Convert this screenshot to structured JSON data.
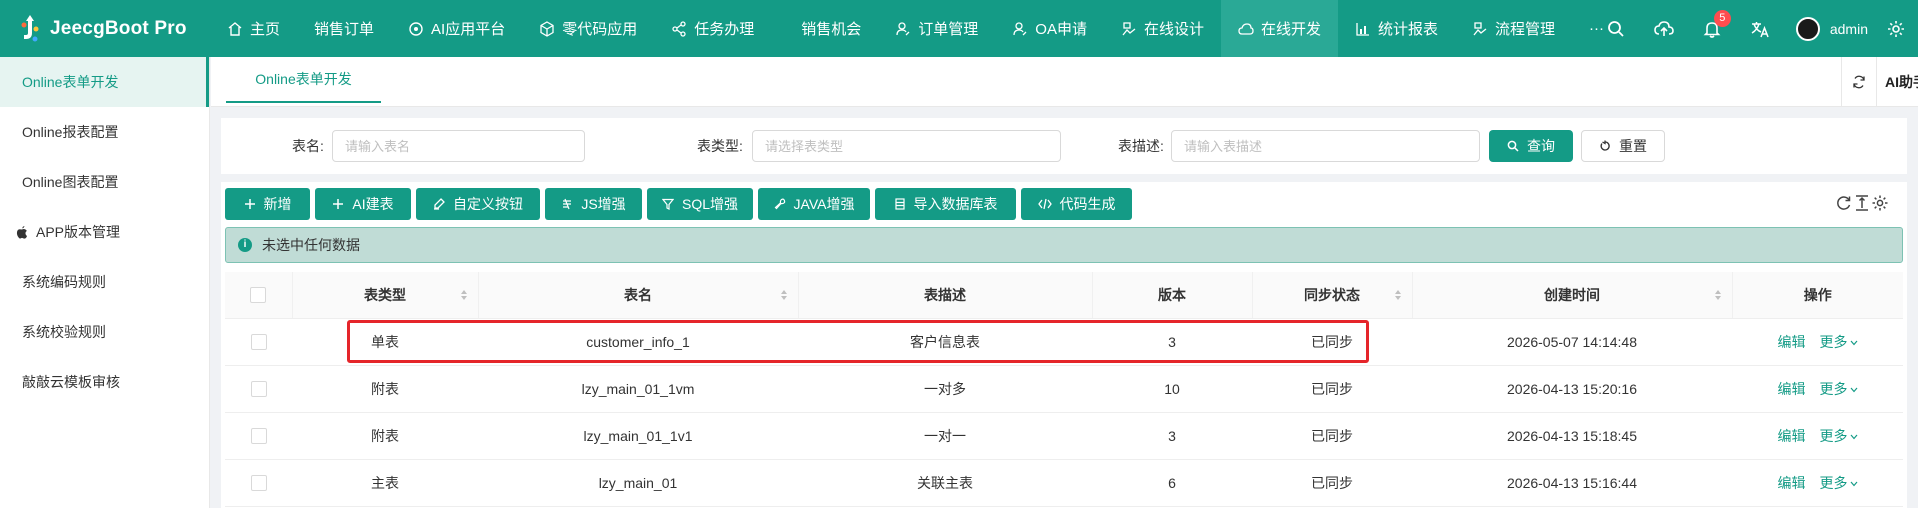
{
  "brand": {
    "name": "JeecgBoot Pro"
  },
  "nav": [
    {
      "label": "主页",
      "icon": "home-icon"
    },
    {
      "label": "销售订单",
      "icon": ""
    },
    {
      "label": "AI应用平台",
      "icon": "ai-icon"
    },
    {
      "label": "零代码应用",
      "icon": "cube-icon"
    },
    {
      "label": "任务办理",
      "icon": "share-icon"
    },
    {
      "label": "销售机会",
      "icon": ""
    },
    {
      "label": "订单管理",
      "icon": "user-icon"
    },
    {
      "label": "OA申请",
      "icon": "user-icon"
    },
    {
      "label": "在线设计",
      "icon": "design-icon"
    },
    {
      "label": "在线开发",
      "icon": "cloud-icon",
      "active": true
    },
    {
      "label": "统计报表",
      "icon": "chart-icon"
    },
    {
      "label": "流程管理",
      "icon": "design-icon"
    },
    {
      "label": "···",
      "icon": ""
    }
  ],
  "header": {
    "notification_count": "5",
    "username": "admin"
  },
  "sidebar": {
    "items": [
      {
        "label": "Online表单开发",
        "active": true
      },
      {
        "label": "Online报表配置"
      },
      {
        "label": "Online图表配置"
      },
      {
        "label": "APP版本管理",
        "icon": "apple-icon"
      },
      {
        "label": "系统编码规则"
      },
      {
        "label": "系统校验规则"
      },
      {
        "label": "敲敲云模板审核"
      }
    ]
  },
  "tabs": {
    "active_label": "Online表单开发",
    "ai_label": "AI助手"
  },
  "search": {
    "table_name_label": "表名:",
    "table_name_placeholder": "请输入表名",
    "table_type_label": "表类型:",
    "table_type_placeholder": "请选择表类型",
    "table_desc_label": "表描述:",
    "table_desc_placeholder": "请输入表描述",
    "query_label": "查询",
    "reset_label": "重置"
  },
  "toolbar": {
    "buttons": [
      {
        "label": "新增",
        "icon": "plus-icon"
      },
      {
        "label": "AI建表",
        "icon": "plus-icon"
      },
      {
        "label": "自定义按钮",
        "icon": "brush-icon"
      },
      {
        "label": "JS增强",
        "icon": "js-icon"
      },
      {
        "label": "SQL增强",
        "icon": "filter-icon"
      },
      {
        "label": "JAVA增强",
        "icon": "tool-icon"
      },
      {
        "label": "导入数据库表",
        "icon": "table-icon"
      },
      {
        "label": "代码生成",
        "icon": "code-icon"
      }
    ]
  },
  "alert": {
    "text": "未选中任何数据"
  },
  "table": {
    "columns": [
      "表类型",
      "表名",
      "表描述",
      "版本",
      "同步状态",
      "创建时间",
      "操作"
    ],
    "rows": [
      {
        "type": "单表",
        "name": "customer_info_1",
        "desc": "客户信息表",
        "version": "3",
        "status": "已同步",
        "created": "2026-05-07 14:14:48",
        "edit": "编辑",
        "more": "更多"
      },
      {
        "type": "附表",
        "name": "lzy_main_01_1vm",
        "desc": "一对多",
        "version": "10",
        "status": "已同步",
        "created": "2026-04-13 15:20:16",
        "edit": "编辑",
        "more": "更多"
      },
      {
        "type": "附表",
        "name": "lzy_main_01_1v1",
        "desc": "一对一",
        "version": "3",
        "status": "已同步",
        "created": "2026-04-13 15:18:45",
        "edit": "编辑",
        "more": "更多"
      },
      {
        "type": "主表",
        "name": "lzy_main_01",
        "desc": "关联主表",
        "version": "6",
        "status": "已同步",
        "created": "2026-04-13 15:16:44",
        "edit": "编辑",
        "more": "更多"
      }
    ]
  },
  "colors": {
    "primary": "#149b86",
    "success": "#52c41a",
    "highlight": "#e5252a",
    "badge": "#ff4d4f"
  }
}
